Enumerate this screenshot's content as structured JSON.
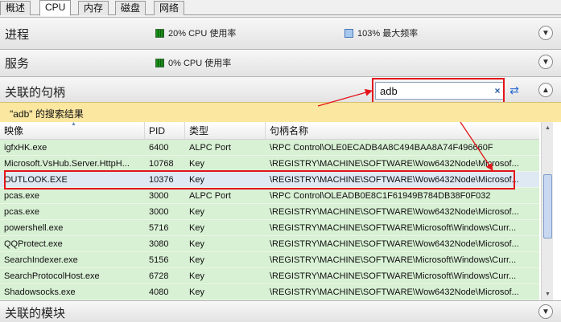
{
  "tabs": [
    {
      "label": "概述"
    },
    {
      "label": "CPU"
    },
    {
      "label": "内存"
    },
    {
      "label": "磁盘"
    },
    {
      "label": "网络"
    }
  ],
  "processes": {
    "title": "进程",
    "cpu_metric": "20% CPU 使用率",
    "freq_metric": "103% 最大频率"
  },
  "services": {
    "title": "服务",
    "cpu_metric": "0% CPU 使用率"
  },
  "handles": {
    "title": "关联的句柄",
    "search_value": "adb",
    "clear_glyph": "×",
    "results_banner": "\"adb\" 的搜索结果",
    "columns": [
      "映像",
      "PID",
      "类型",
      "句柄名称"
    ],
    "rows": [
      [
        "igfxHK.exe",
        "6400",
        "ALPC Port",
        "\\RPC Control\\OLE0ECADB4A8C494BAA8A74F496660F"
      ],
      [
        "Microsoft.VsHub.Server.HttpH...",
        "10768",
        "Key",
        "\\REGISTRY\\MACHINE\\SOFTWARE\\Wow6432Node\\Microsof..."
      ],
      [
        "OUTLOOK.EXE",
        "10376",
        "Key",
        "\\REGISTRY\\MACHINE\\SOFTWARE\\Wow6432Node\\Microsof..."
      ],
      [
        "pcas.exe",
        "3000",
        "ALPC Port",
        "\\RPC Control\\OLEADB0E8C1F61949B784DB38F0F032"
      ],
      [
        "pcas.exe",
        "3000",
        "Key",
        "\\REGISTRY\\MACHINE\\SOFTWARE\\Wow6432Node\\Microsof..."
      ],
      [
        "powershell.exe",
        "5716",
        "Key",
        "\\REGISTRY\\MACHINE\\SOFTWARE\\Microsoft\\Windows\\Curr..."
      ],
      [
        "QQProtect.exe",
        "3080",
        "Key",
        "\\REGISTRY\\MACHINE\\SOFTWARE\\Wow6432Node\\Microsof..."
      ],
      [
        "SearchIndexer.exe",
        "5156",
        "Key",
        "\\REGISTRY\\MACHINE\\SOFTWARE\\Microsoft\\Windows\\Curr..."
      ],
      [
        "SearchProtocolHost.exe",
        "6728",
        "Key",
        "\\REGISTRY\\MACHINE\\SOFTWARE\\Microsoft\\Windows\\Curr..."
      ],
      [
        "Shadowsocks.exe",
        "4080",
        "Key",
        "\\REGISTRY\\MACHINE\\SOFTWARE\\Wow6432Node\\Microsof..."
      ]
    ],
    "selected_row": 2
  },
  "modules": {
    "title": "关联的模块"
  },
  "colors": {
    "highlight": "#e3151a",
    "row_bg": "#d8f0d4",
    "banner": "#fbe7a0"
  }
}
